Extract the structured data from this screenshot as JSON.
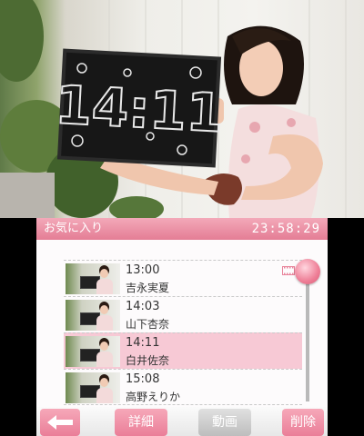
{
  "header": {
    "title": "お気に入り",
    "clock": "23:58:29"
  },
  "photo": {
    "board_text": "14:11"
  },
  "list": [
    {
      "time": "13:00",
      "name": "吉永実夏",
      "has_video": true,
      "selected": false
    },
    {
      "time": "14:03",
      "name": "山下杏奈",
      "has_video": false,
      "selected": false
    },
    {
      "time": "14:11",
      "name": "白井佐奈",
      "has_video": false,
      "selected": true
    },
    {
      "time": "15:08",
      "name": "高野えりか",
      "has_video": false,
      "selected": false
    }
  ],
  "toolbar": {
    "back_icon": "left-arrow-icon",
    "detail_label": "詳細",
    "video_label": "動画",
    "delete_label": "削除"
  },
  "colors": {
    "accent": "#e47d95",
    "selected_row": "#f7c9d5"
  }
}
